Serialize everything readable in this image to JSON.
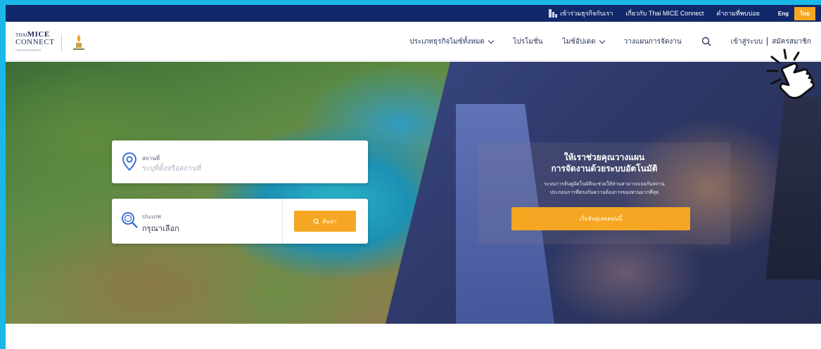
{
  "topbar": {
    "join": "เข้าร่วมธุรกิจกับเรา",
    "about": "เกี่ยวกับ Thai MICE Connect",
    "faq": "คำถามที่พบบ่อย",
    "lang_en": "Eng",
    "lang_th": "ไทย"
  },
  "logo": {
    "line1_small": "THAI",
    "line1_big": "MICE",
    "line2": "CONNECT",
    "line3": "ONE-STOP SERVICE"
  },
  "nav": {
    "all_business": "ประเภทธุรกิจไมซ์ทั้งหมด",
    "promotion": "โปรโมชั่น",
    "mice_update": "ไมซ์อัปเดต",
    "event_planning": "วางแผนการจัดงาน",
    "login": "เข้าสู่ระบบ",
    "register": "สมัครสมาชิก"
  },
  "search": {
    "location_label": "สถานที่",
    "location_placeholder": "ระบุที่ตั้งหรือสถานที่",
    "type_label": "ประเภท",
    "type_value": "กรุณาเลือก",
    "find_button": "ค้นหา"
  },
  "promo": {
    "title1": "ให้เราช่วยคุณวางแผน",
    "title2": "การจัดงานด้วยระบบอัตโนมัติ",
    "desc1": "ระบบการจับคู่อัตโนมัติจะช่วยให้ท่านสามารถเจอกับสถาน",
    "desc2": "ประกอบการที่ตรงกับความต้องการของท่านมากที่สุด",
    "cta": "เริ่มจับคู่เลยตอนนี้"
  },
  "colors": {
    "frame_bg": "#1ab8e8",
    "topbar": "#11296b",
    "accent": "#f5a623",
    "nav_text": "#2b3560"
  }
}
